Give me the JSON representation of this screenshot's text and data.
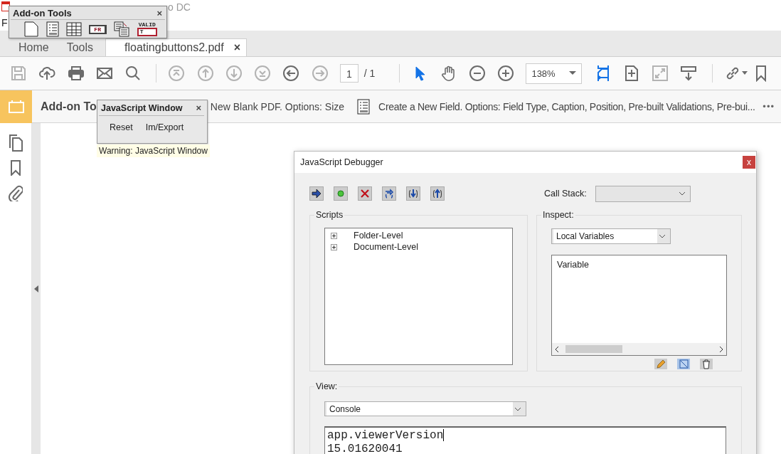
{
  "window": {
    "title": "o DC"
  },
  "menu_bar": [
    "F"
  ],
  "tabs": [
    {
      "label": "Home",
      "selected": false
    },
    {
      "label": "Tools",
      "selected": false
    },
    {
      "label": "floatingbuttons2.pdf",
      "selected": true,
      "close": "×"
    }
  ],
  "toolbar": [
    {
      "kind": "save",
      "disabled": true
    },
    {
      "kind": "upload",
      "disabled": false
    },
    {
      "kind": "print",
      "disabled": false
    },
    {
      "kind": "mail",
      "disabled": false
    },
    {
      "kind": "search",
      "disabled": false
    },
    {
      "kind": "sep"
    },
    {
      "kind": "first",
      "disabled": true
    },
    {
      "kind": "prev",
      "disabled": true
    },
    {
      "kind": "next",
      "disabled": true
    },
    {
      "kind": "last",
      "disabled": true
    },
    {
      "kind": "back",
      "disabled": false
    },
    {
      "kind": "forward",
      "disabled": true
    },
    {
      "kind": "page",
      "value": "1",
      "total": "/ 1"
    },
    {
      "kind": "sep"
    },
    {
      "kind": "select",
      "disabled": false,
      "selected": true
    },
    {
      "kind": "hand",
      "disabled": false
    },
    {
      "kind": "zoomout",
      "disabled": false
    },
    {
      "kind": "zoomin",
      "disabled": false
    },
    {
      "kind": "zoom",
      "value": "138%"
    },
    {
      "kind": "fitwidth",
      "disabled": false,
      "selected": true
    },
    {
      "kind": "fitpage",
      "disabled": false
    },
    {
      "kind": "fullscreen",
      "disabled": true
    },
    {
      "kind": "readmode",
      "disabled": false
    },
    {
      "kind": "sep"
    },
    {
      "kind": "link",
      "disabled": false
    },
    {
      "kind": "bookmark",
      "disabled": false
    }
  ],
  "addon_bar": {
    "title": "Add-on To",
    "items": [
      "New Blank PDF. Options: Size",
      "Create a New Field. Options: Field Type, Caption, Position, Pre-built Validations, Pre-bui..."
    ],
    "more": "•••"
  },
  "addon_palette": {
    "title": "Add-on Tools",
    "close": "×",
    "tools": [
      {
        "kind": "page"
      },
      {
        "kind": "field"
      },
      {
        "kind": "table"
      },
      {
        "kind": "fr",
        "label": "FR"
      },
      {
        "kind": "copy"
      },
      {
        "kind": "valid",
        "label": "VALID",
        "sub": "T"
      }
    ]
  },
  "js_palette": {
    "title": "JavaScript Window",
    "close": "×",
    "buttons": [
      "Reset",
      "Im/Export"
    ],
    "warning": "Warning: JavaScript Window"
  },
  "debugger": {
    "title": "JavaScript Debugger",
    "close": "x",
    "buttons": [
      {
        "kind": "go"
      },
      {
        "kind": "breakpoint"
      },
      {
        "kind": "stop"
      },
      {
        "kind": "stepover"
      },
      {
        "kind": "stepinto"
      },
      {
        "kind": "stepout"
      }
    ],
    "call_stack_label": "Call Stack:",
    "scripts": {
      "label": "Scripts",
      "items": [
        {
          "label": "Folder-Level",
          "expanded": false
        },
        {
          "label": "Document-Level",
          "expanded": false
        }
      ]
    },
    "inspect": {
      "label": "Inspect:",
      "dropdown": "Local Variables",
      "header": "Variable"
    },
    "view": {
      "label": "View:",
      "dropdown": "Console",
      "console": [
        "app.viewerVersion",
        "15.01620041"
      ]
    }
  }
}
